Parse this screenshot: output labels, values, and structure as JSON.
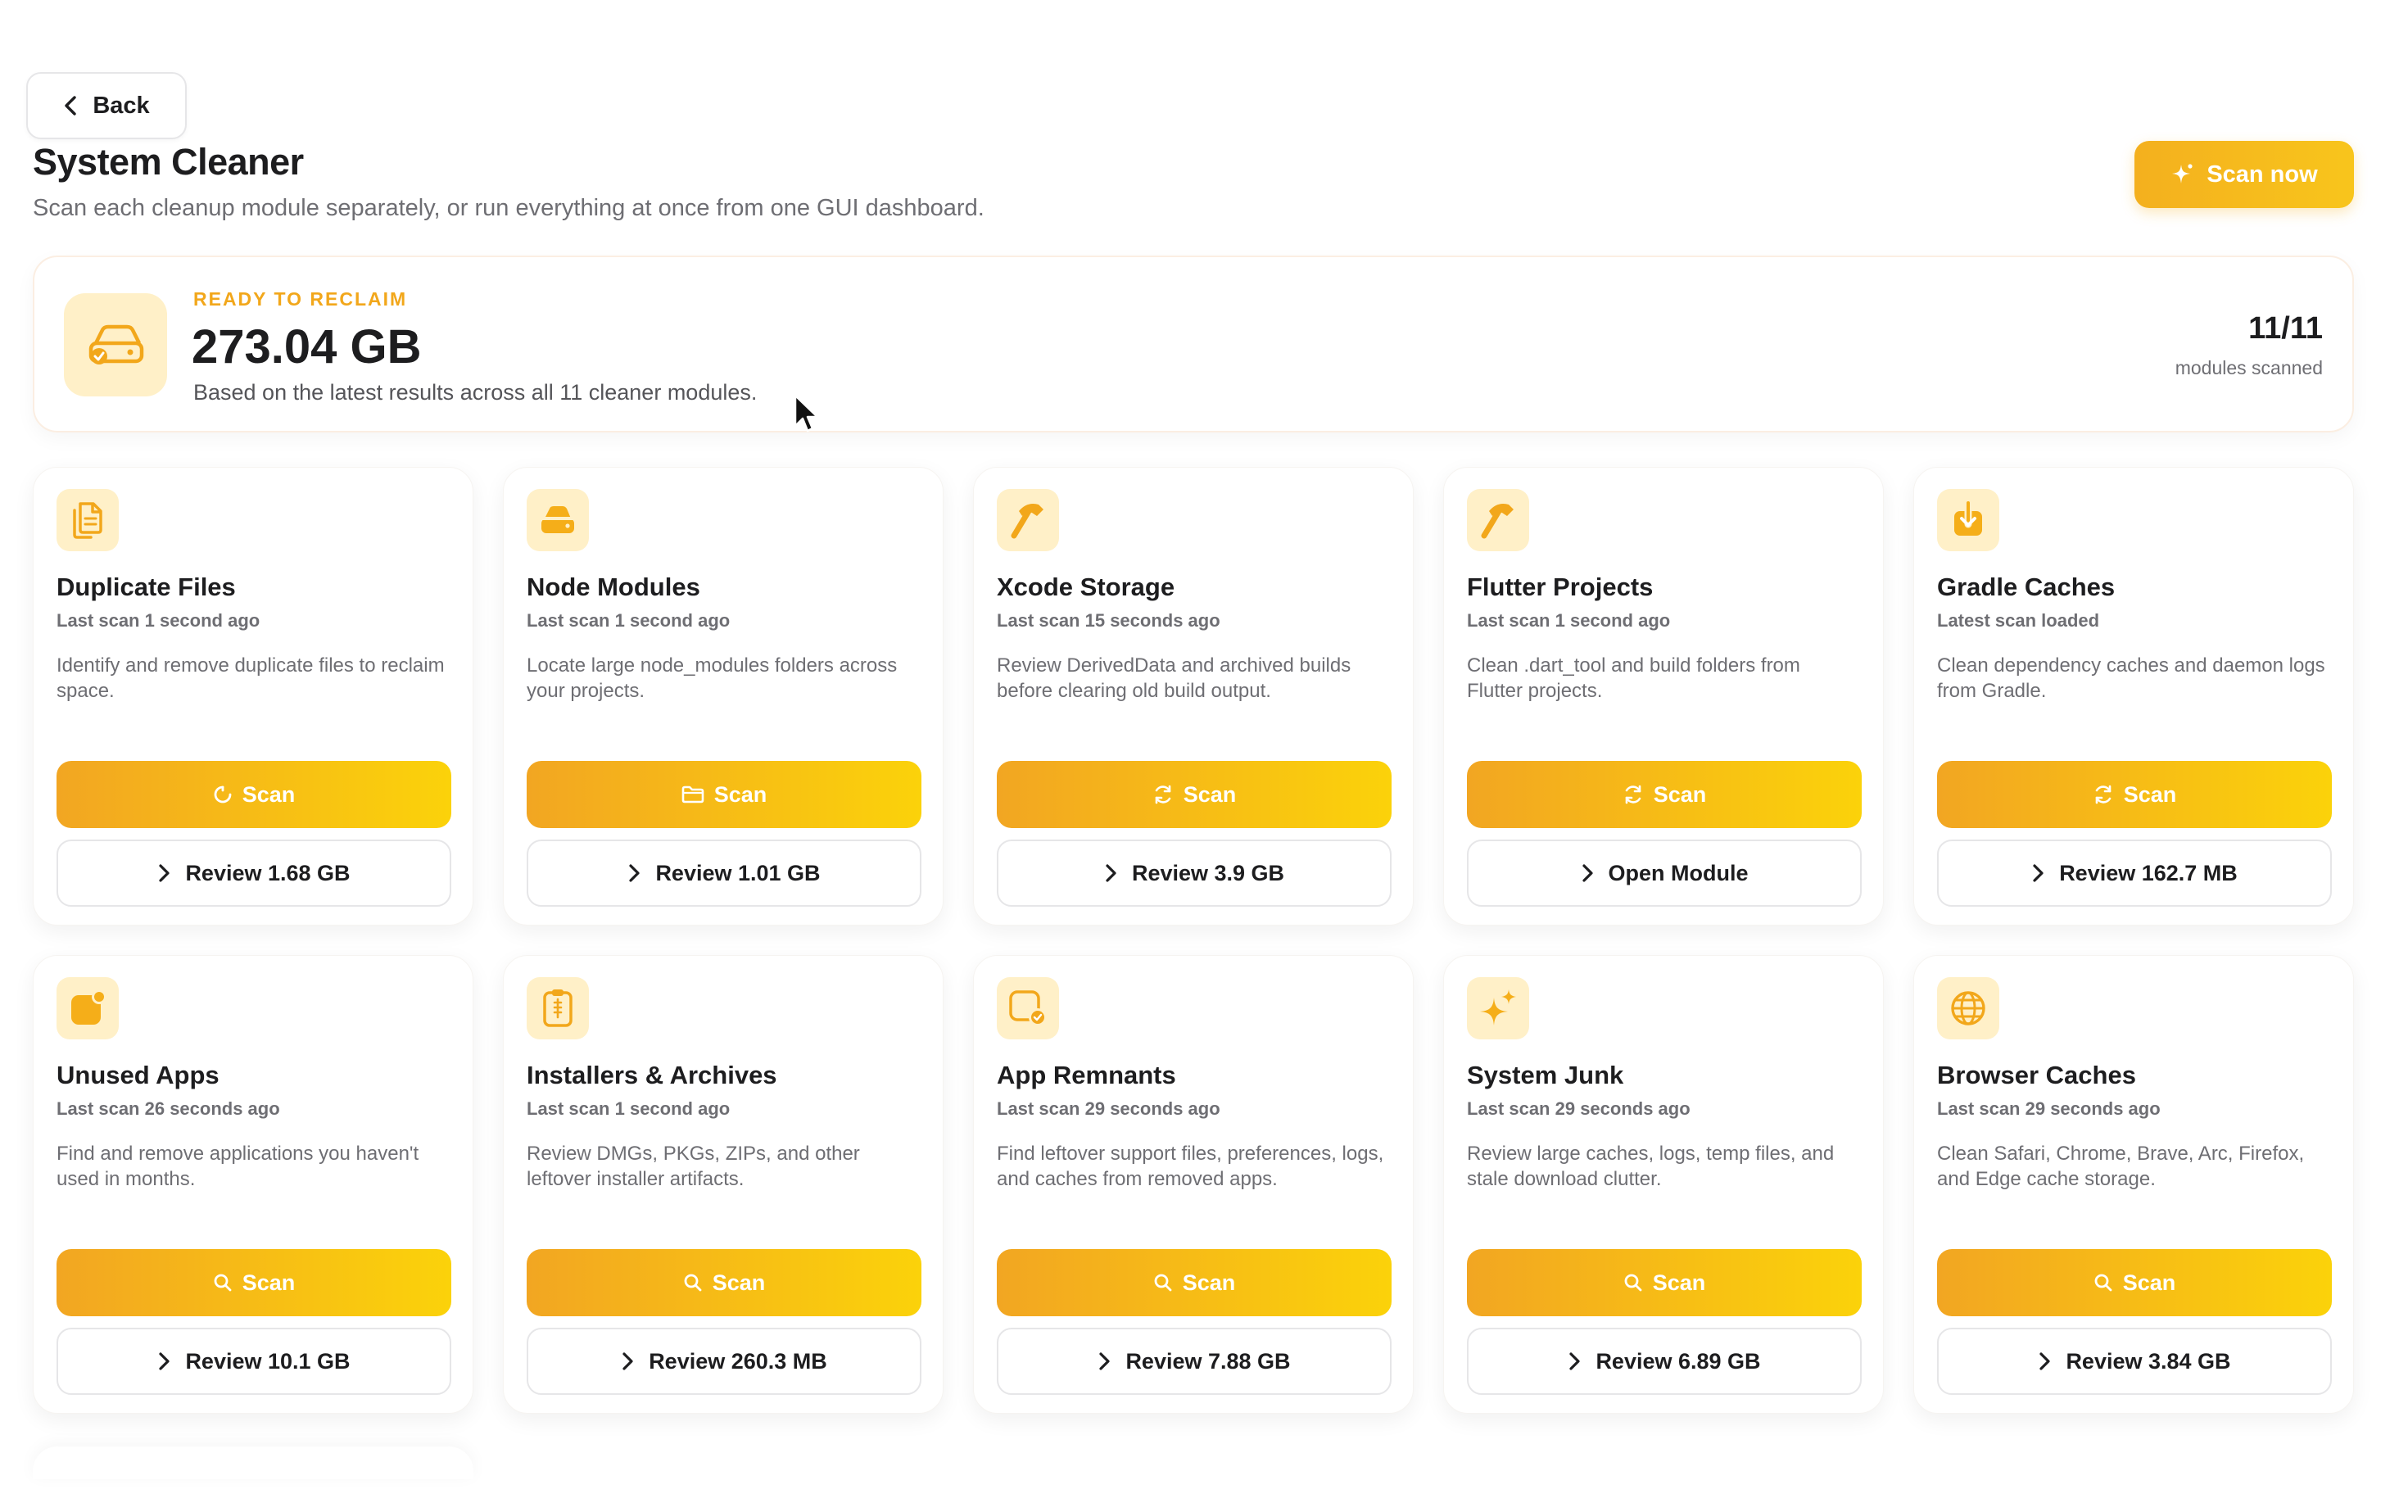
{
  "header": {
    "back_label": "Back",
    "title": "System Cleaner",
    "subtitle": "Scan each cleanup module separately, or run everything at once from one GUI dashboard.",
    "scan_now_label": "Scan now"
  },
  "summary": {
    "label": "READY TO RECLAIM",
    "value": "273.04 GB",
    "description": "Based on the latest results across all 11 cleaner modules.",
    "count": "11/11",
    "count_label": "modules scanned",
    "icon": "drive-check-icon"
  },
  "accent": "#f4b01e",
  "modules": [
    {
      "title": "Duplicate Files",
      "status": "Last scan 1 second ago",
      "description": "Identify and remove duplicate files to reclaim space.",
      "scan_label": "Scan",
      "review_label": "Review 1.68 GB",
      "icon": "documents-icon",
      "scan_icon": "spinner-icon"
    },
    {
      "title": "Node Modules",
      "status": "Last scan 1 second ago",
      "description": "Locate large node_modules folders across your projects.",
      "scan_label": "Scan",
      "review_label": "Review 1.01 GB",
      "icon": "drive-icon",
      "scan_icon": "folder-icon"
    },
    {
      "title": "Xcode Storage",
      "status": "Last scan 15 seconds ago",
      "description": "Review DerivedData and archived builds before clearing old build output.",
      "scan_label": "Scan",
      "review_label": "Review 3.9 GB",
      "icon": "hammer-icon",
      "scan_icon": "refresh-icon"
    },
    {
      "title": "Flutter Projects",
      "status": "Last scan 1 second ago",
      "description": "Clean .dart_tool and build folders from Flutter projects.",
      "scan_label": "Scan",
      "review_label": "Open Module",
      "icon": "hammer-icon",
      "scan_icon": "refresh-icon"
    },
    {
      "title": "Gradle Caches",
      "status": "Latest scan loaded",
      "description": "Clean dependency caches and daemon logs from Gradle.",
      "scan_label": "Scan",
      "review_label": "Review 162.7 MB",
      "icon": "download-tray-icon",
      "scan_icon": "refresh-icon"
    },
    {
      "title": "Unused Apps",
      "status": "Last scan 26 seconds ago",
      "description": "Find and remove applications you haven't used in months.",
      "scan_label": "Scan",
      "review_label": "Review 10.1 GB",
      "icon": "app-badge-icon",
      "scan_icon": "search-icon"
    },
    {
      "title": "Installers & Archives",
      "status": "Last scan 1 second ago",
      "description": "Review DMGs, PKGs, ZIPs, and other leftover installer artifacts.",
      "scan_label": "Scan",
      "review_label": "Review 260.3 MB",
      "icon": "archive-icon",
      "scan_icon": "search-icon"
    },
    {
      "title": "App Remnants",
      "status": "Last scan 29 seconds ago",
      "description": "Find leftover support files, preferences, logs, and caches from removed apps.",
      "scan_label": "Scan",
      "review_label": "Review 7.88 GB",
      "icon": "app-check-icon",
      "scan_icon": "search-icon"
    },
    {
      "title": "System Junk",
      "status": "Last scan 29 seconds ago",
      "description": "Review large caches, logs, temp files, and stale download clutter.",
      "scan_label": "Scan",
      "review_label": "Review 6.89 GB",
      "icon": "sparkles-icon",
      "scan_icon": "search-icon"
    },
    {
      "title": "Browser Caches",
      "status": "Last scan 29 seconds ago",
      "description": "Clean Safari, Chrome, Brave, Arc, Firefox, and Edge cache storage.",
      "scan_label": "Scan",
      "review_label": "Review 3.84 GB",
      "icon": "globe-icon",
      "scan_icon": "search-icon"
    }
  ]
}
